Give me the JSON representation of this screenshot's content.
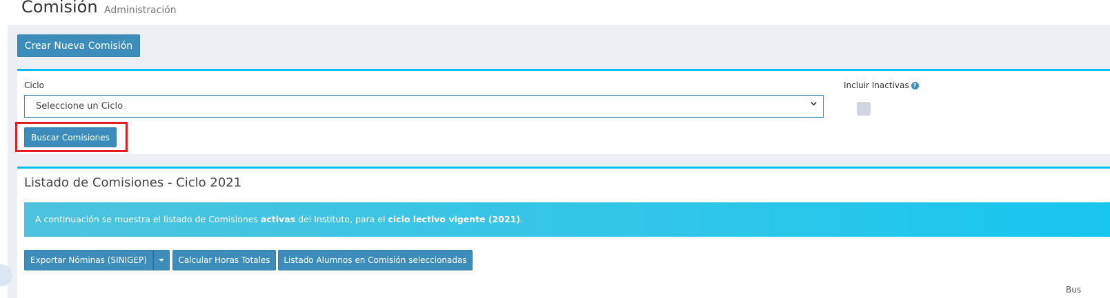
{
  "header": {
    "title": "Comisión",
    "subtitle": "Administración"
  },
  "actions": {
    "new_commission": "Crear Nueva Comisión"
  },
  "filter": {
    "cycle_label": "Ciclo",
    "cycle_value": "Seleccione un Ciclo",
    "include_inactive_label": "Incluir Inactivas",
    "include_inactive_checked": false,
    "search_button": "Buscar Comisiones"
  },
  "list": {
    "title": "Listado de Comisiones - Ciclo 2021",
    "callout": {
      "part1": "A continuación se muestra el listado de Comisiones ",
      "bold1": "activas",
      "part2": " del Instituto, para el ",
      "bold2": "ciclo lectivo vigente (2021)",
      "part3": "."
    },
    "buttons": {
      "export": "Exportar Nóminas (SINIGEP)",
      "hours": "Calcular Horas Totales",
      "students": "Listado Alumnos en Comisión seleccionadas"
    },
    "search_fragment": "Bus"
  },
  "icons": {
    "help": "question-circle-icon",
    "dropdown": "chevron-down-icon",
    "caret": "caret-down-icon"
  },
  "colors": {
    "primary": "#3c8dbc",
    "box_border": "#00c0ef",
    "highlight": "#e41d24",
    "background": "#ecf0f5"
  }
}
